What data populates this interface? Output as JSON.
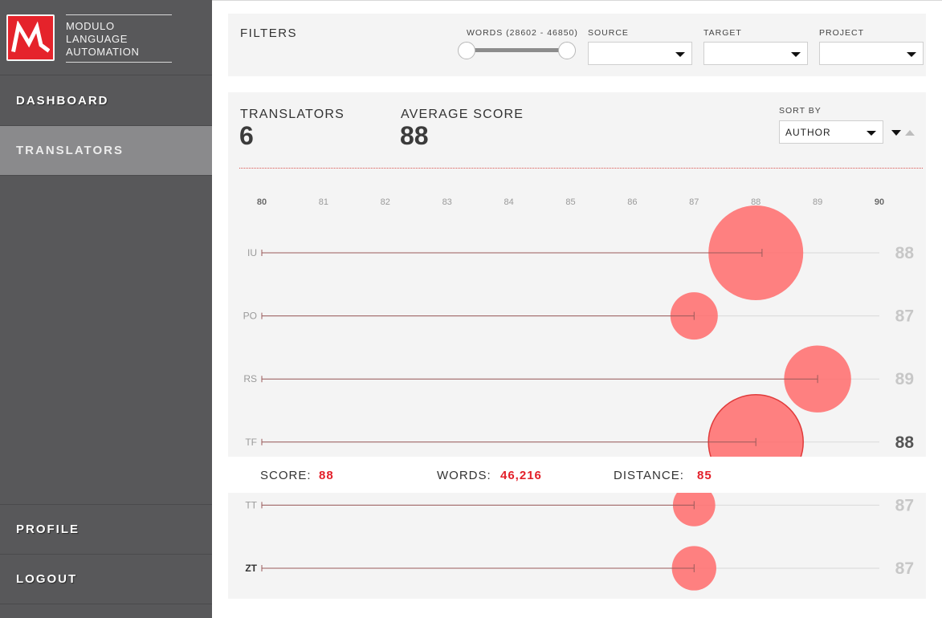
{
  "app": {
    "logo_lines": [
      "MODULO",
      "LANGUAGE",
      "AUTOMATION"
    ]
  },
  "nav": {
    "dashboard": "DASHBOARD",
    "translators": "TRANSLATORS",
    "profile": "PROFILE",
    "logout": "LOGOUT"
  },
  "filters": {
    "title": "FILTERS",
    "words_label": "WORDS (28602 - 46850)",
    "source_label": "SOURCE",
    "target_label": "TARGET",
    "project_label": "PROJECT",
    "source_value": "",
    "target_value": "",
    "project_value": ""
  },
  "summary": {
    "translators_label": "TRANSLATORS",
    "translators_value": "6",
    "avg_label": "AVERAGE SCORE",
    "avg_value": "88",
    "sortby_label": "SORT BY",
    "sortby_value": "AUTHOR"
  },
  "colors": {
    "accent": "#e3202a",
    "bubble": "#ff6b6b"
  },
  "chart_data": {
    "type": "scatter",
    "x_ticks": [
      "80",
      "81",
      "82",
      "83",
      "84",
      "85",
      "86",
      "87",
      "88",
      "89",
      "90"
    ],
    "xlim": [
      80,
      90
    ],
    "series": [
      {
        "label": "IU",
        "score": 88,
        "marker": 88.1,
        "bubble": 88.0,
        "size": 1.0,
        "highlight": false
      },
      {
        "label": "PO",
        "score": 87,
        "marker": 87.0,
        "bubble": 87.0,
        "size": 0.25,
        "highlight": false
      },
      {
        "label": "RS",
        "score": 89,
        "marker": 89.0,
        "bubble": 89.0,
        "size": 0.5,
        "highlight": false
      },
      {
        "label": "TF",
        "score": 88,
        "marker": 88.0,
        "bubble": 88.0,
        "size": 1.0,
        "highlight": true
      },
      {
        "label": "TT",
        "score": 87,
        "marker": 87.0,
        "bubble": 87.0,
        "size": 0.2,
        "highlight": false
      },
      {
        "label": "ZT",
        "score": 87,
        "marker": 87.0,
        "bubble": 87.0,
        "size": 0.22,
        "highlight": false
      }
    ]
  },
  "tooltip": {
    "score_label": "SCORE:",
    "score_value": "88",
    "words_label": "WORDS:",
    "words_value": "46,216",
    "distance_label": "DISTANCE:",
    "distance_value": "85"
  }
}
